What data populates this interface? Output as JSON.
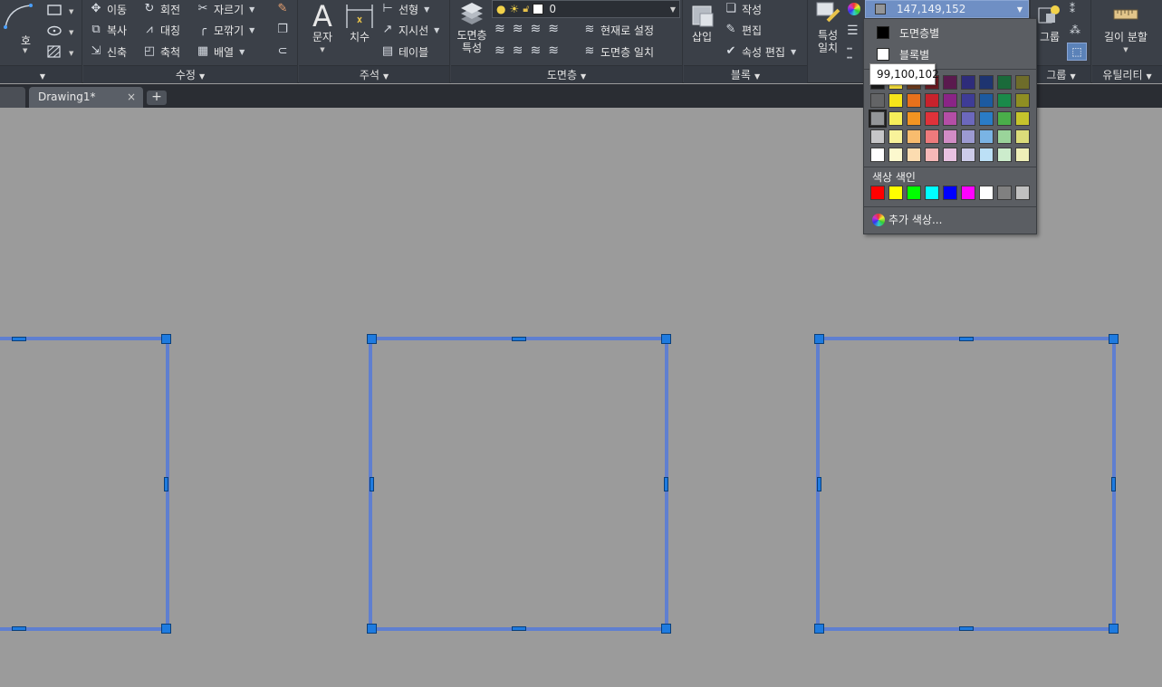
{
  "ribbon": {
    "draw_panel": {
      "arc_label": "호"
    },
    "modify_panel": {
      "title": "수정",
      "move": "이동",
      "rotate": "회전",
      "trim": "자르기",
      "copy": "복사",
      "mirror": "대칭",
      "fillet": "모깎기",
      "stretch": "신축",
      "scale": "축척",
      "array": "배열"
    },
    "annotation_panel": {
      "title": "주석",
      "text": "문자",
      "dimension": "치수",
      "linear": "선형",
      "leader": "지시선",
      "table": "테이블"
    },
    "layers_panel": {
      "title": "도면층",
      "layer_props_line1": "도면층",
      "layer_props_line2": "특성",
      "current_layer": "0",
      "make_current": "현재로 설정",
      "match_layer": "도면층 일치"
    },
    "block_panel": {
      "title": "블록",
      "insert": "삽입",
      "create": "작성",
      "edit": "편집",
      "edit_attributes": "속성 편집"
    },
    "properties_panel": {
      "match_line1": "특성",
      "match_line2": "일치",
      "color_value": "147,149,152"
    },
    "groups_panel": {
      "title": "그룹",
      "group": "그룹"
    },
    "utilities_panel": {
      "title": "유틸리티",
      "measure": "길이 분할"
    }
  },
  "tabs": {
    "drawing_tab": "Drawing1*",
    "close_glyph": "×",
    "add_glyph": "+"
  },
  "color_dropdown": {
    "by_layer": "도면층별",
    "by_block": "블록별",
    "index_color_label": "색상 색인",
    "more_colors": "추가 색상...",
    "tooltip": "99,100,102",
    "palette_rows": [
      [
        "#1a1a1a",
        "#f2dc3a",
        "#6b3a1c",
        "#6b1a22",
        "#5a1a4e",
        "#2e2c7a",
        "#1e3470",
        "#1a6a3a",
        "#6e6c2a"
      ],
      [
        "#636466",
        "#f5e41a",
        "#e8711c",
        "#c8222c",
        "#8a2486",
        "#3e3c96",
        "#1c5aa0",
        "#1a8a4a",
        "#8f8e22"
      ],
      [
        "#939598",
        "#f6ee5a",
        "#f39422",
        "#e0323a",
        "#b44ea6",
        "#6c68bc",
        "#2a7cc6",
        "#4aae4a",
        "#c6c42c"
      ],
      [
        "#c6c6c8",
        "#f8f29a",
        "#f8bc6e",
        "#ee7a7c",
        "#d28cc6",
        "#9c9ad2",
        "#7ab4e4",
        "#9ad49a",
        "#dcdc7a"
      ],
      [
        "#ffffff",
        "#fcf8ce",
        "#fcdcb0",
        "#f6b8b8",
        "#e8c2e2",
        "#cccbe8",
        "#bce0f6",
        "#cceccc",
        "#eeeeb8"
      ]
    ],
    "selected_swatch": "#939598",
    "index_colors": [
      "#ff0000",
      "#ffff00",
      "#00ff00",
      "#00ffff",
      "#0000ff",
      "#ff00ff",
      "#ffffff",
      "#808080",
      "#c0c0c0"
    ]
  },
  "colors": {
    "ribbon_bg": "#3b4048",
    "canvas_bg": "#9b9b9b",
    "selection": "#5f7fd0",
    "grip": "#1e7be0",
    "combo_highlight": "#6f8fc4"
  }
}
